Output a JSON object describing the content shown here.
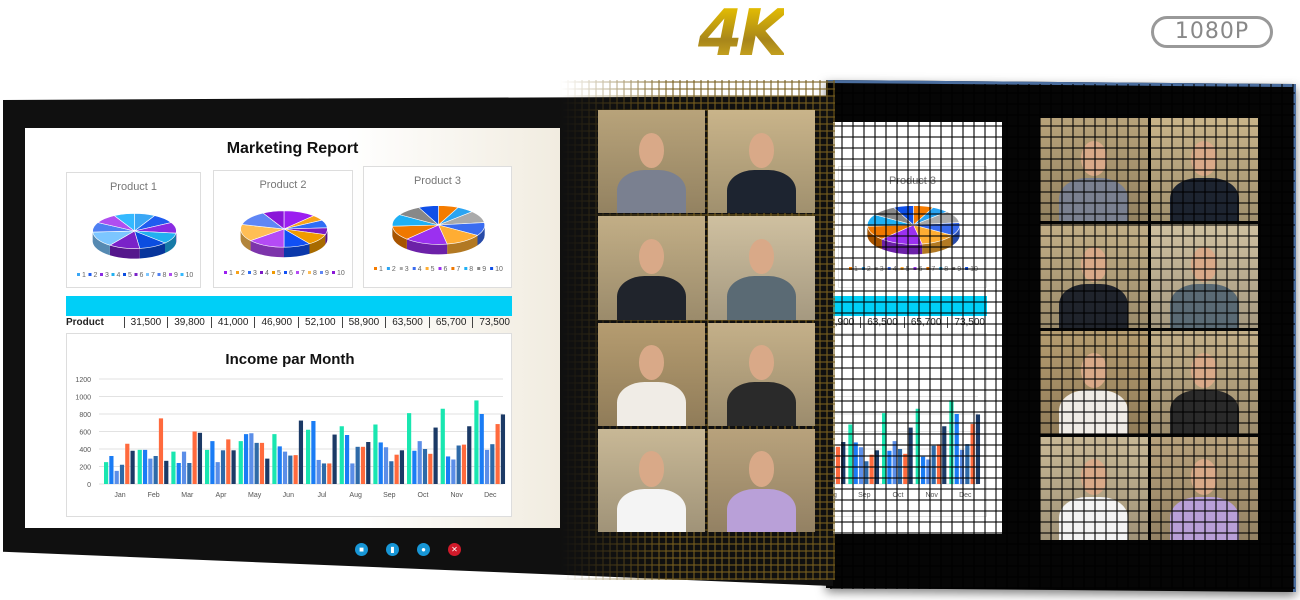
{
  "branding": {
    "logo_4k": "4K",
    "badge": "1080P"
  },
  "slide": {
    "title": "Marketing Report",
    "products": [
      {
        "title": "Product 1",
        "values": [
          8,
          9,
          10,
          10,
          11,
          12,
          14,
          9,
          9,
          8
        ],
        "colors": [
          "#3aa7f5",
          "#1f5cf0",
          "#8a2be2",
          "#22b0f0",
          "#0b4de0",
          "#7a22c8",
          "#7cc6ff",
          "#4e7ff2",
          "#b04ef0",
          "#34b9ff"
        ]
      },
      {
        "title": "Product 2",
        "values": [
          12,
          5,
          7,
          6,
          10,
          10,
          14,
          15,
          13,
          8
        ],
        "colors": [
          "#9b1ff0",
          "#f8a31a",
          "#2f6df5",
          "#7a1bc4",
          "#f09a00",
          "#1050f5",
          "#b44bf5",
          "#ffbe55",
          "#5f86f5",
          "#8a16d8"
        ]
      },
      {
        "title": "Product 3",
        "values": [
          7,
          6,
          10,
          11,
          13,
          15,
          12,
          10,
          9,
          7
        ],
        "colors": [
          "#f57c00",
          "#2aa4f2",
          "#aaaaaa",
          "#3a6cf0",
          "#ffad33",
          "#9b30f0",
          "#f07800",
          "#1fb0f5",
          "#888888",
          "#0f4fe8"
        ]
      }
    ],
    "legend_labels": [
      "1",
      "2",
      "3",
      "4",
      "5",
      "6",
      "7",
      "8",
      "9",
      "10"
    ],
    "table": {
      "label": "Product",
      "values": [
        "31,500",
        "39,800",
        "41,000",
        "46,900",
        "52,100",
        "58,900",
        "63,500",
        "65,700",
        "73,500"
      ]
    }
  },
  "chart_data": {
    "type": "bar",
    "title": "Income par Month",
    "categories": [
      "Jan",
      "Feb",
      "Mar",
      "Apr",
      "May",
      "Jun",
      "Jul",
      "Aug",
      "Sep",
      "Oct",
      "Nov",
      "Dec"
    ],
    "ylim": [
      0,
      1200
    ],
    "yticks": [
      "0",
      "200",
      "400",
      "600",
      "800",
      "1000",
      "1200"
    ],
    "grid": true,
    "series": [
      {
        "values": [
          250,
          390,
          370,
          390,
          490,
          570,
          620,
          660,
          680,
          810,
          860,
          955
        ],
        "color": "#19e6b0"
      },
      {
        "values": [
          320,
          390,
          240,
          490,
          570,
          430,
          720,
          560,
          475,
          380,
          315,
          800
        ],
        "color": "#1a7cf5"
      },
      {
        "values": [
          150,
          290,
          370,
          250,
          580,
          370,
          275,
          235,
          420,
          490,
          280,
          390
        ],
        "color": "#5b8ee8"
      },
      {
        "values": [
          220,
          320,
          240,
          385,
          470,
          325,
          235,
          425,
          260,
          400,
          440,
          455
        ],
        "color": "#2e6aa8"
      },
      {
        "values": [
          460,
          750,
          600,
          510,
          470,
          330,
          235,
          425,
          335,
          345,
          450,
          685
        ],
        "color": "#ff6a3d"
      },
      {
        "values": [
          380,
          265,
          585,
          385,
          290,
          725,
          565,
          480,
          385,
          645,
          660,
          795
        ],
        "color": "#1b3a66"
      }
    ]
  },
  "controls": [
    {
      "name": "camera",
      "icon": "video-camera-icon",
      "color": "#1796d6"
    },
    {
      "name": "signal",
      "icon": "signal-bars-icon",
      "color": "#1796d6"
    },
    {
      "name": "chat",
      "icon": "chat-bubble-icon",
      "color": "#1796d6"
    },
    {
      "name": "end-call",
      "icon": "close-icon",
      "color": "#d11a2a"
    }
  ],
  "participants": [
    {
      "bg": "#b8a37a",
      "shirt": "#7a8090"
    },
    {
      "bg": "#c9b48a",
      "shirt": "#1d2430"
    },
    {
      "bg": "#c2ae86",
      "shirt": "#20242c"
    },
    {
      "bg": "#cfc0a0",
      "shirt": "#5a6a74"
    },
    {
      "bg": "#b59c70",
      "shirt": "#f0ece6"
    },
    {
      "bg": "#c4b089",
      "shirt": "#2a2a2a"
    },
    {
      "bg": "#c8b896",
      "shirt": "#f4f4f4"
    },
    {
      "bg": "#b8a27c",
      "shirt": "#b9a0d8"
    }
  ]
}
